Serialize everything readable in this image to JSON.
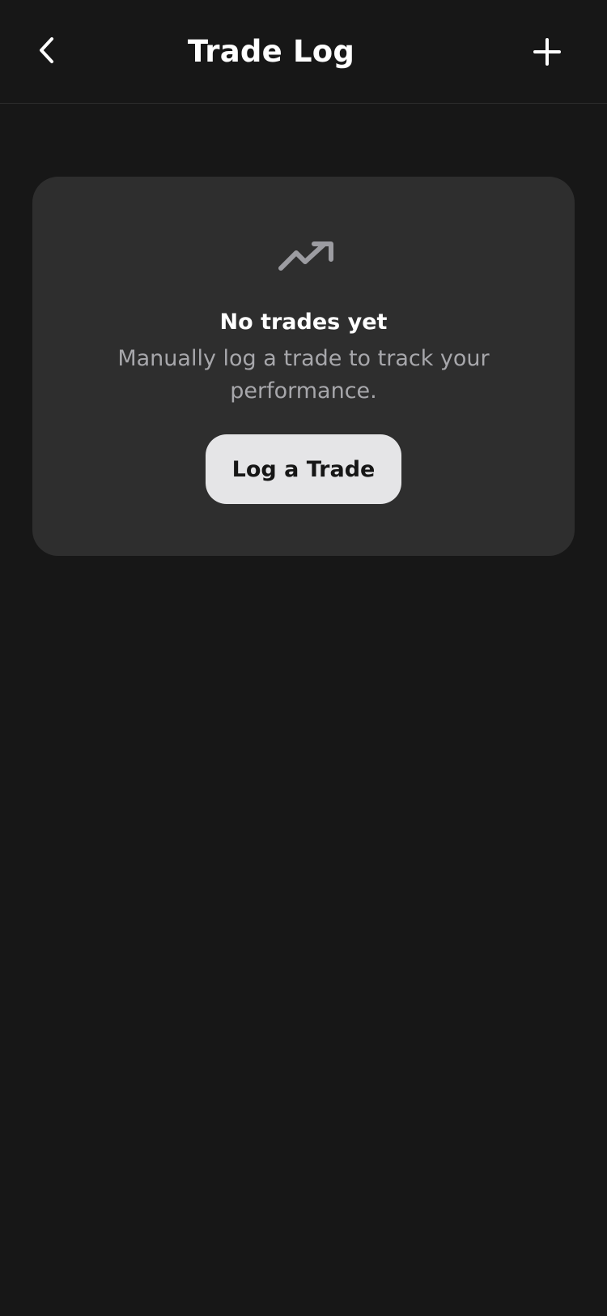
{
  "header": {
    "title": "Trade Log",
    "back_icon": "chevron-left-icon",
    "add_icon": "plus-icon"
  },
  "empty_state": {
    "icon": "trending-up-icon",
    "title": "No trades yet",
    "description": "Manually log a trade to track your performance.",
    "button_label": "Log a Trade"
  },
  "colors": {
    "background": "#171717",
    "card": "#2e2e2e",
    "muted_text": "#a7a7ab",
    "button_background": "#e5e5e7"
  }
}
